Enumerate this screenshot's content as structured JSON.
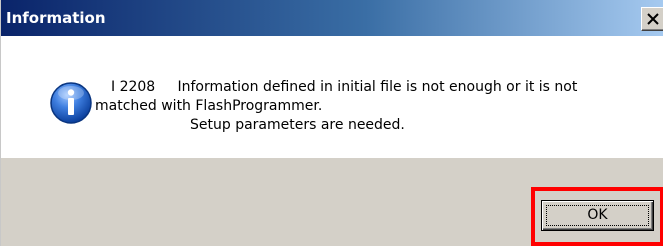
{
  "window": {
    "title": "Information",
    "close_icon": "close-icon"
  },
  "message": {
    "icon": "information-icon",
    "line1": "I 2208     Information defined in initial file is not enough or it is not",
    "line2": "matched with FlashProgrammer.",
    "line3": "Setup parameters are needed."
  },
  "buttons": {
    "ok_label": "OK"
  },
  "colors": {
    "title_start": "#0a246a",
    "title_end": "#a6caf0",
    "dialog_face": "#d4d0c8",
    "highlight": "#ff0000",
    "icon_blue": "#1f5fbf"
  }
}
